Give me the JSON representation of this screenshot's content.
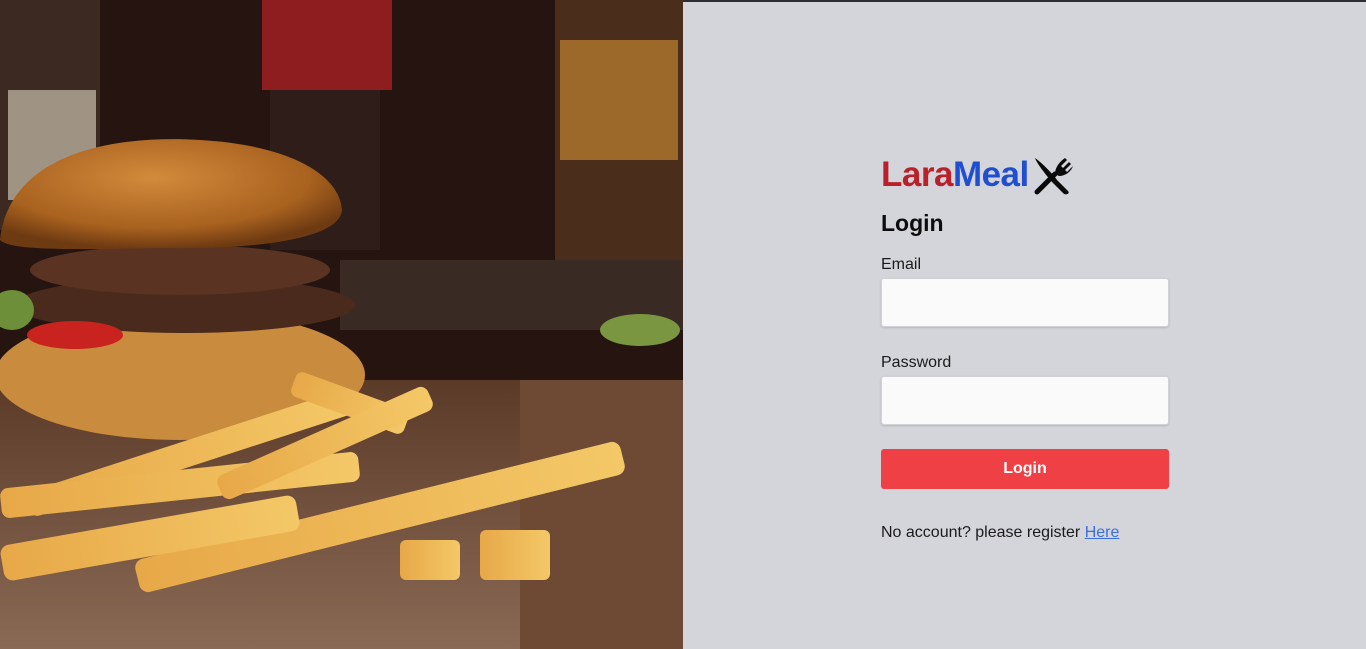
{
  "hero": {
    "image": "burger-and-fries-photo"
  },
  "brand": {
    "part1": "Lara",
    "part2": "Meal",
    "icon": "fork-knife-crossed-icon",
    "color1": "#b9202a",
    "color2": "#1f4fd0"
  },
  "login": {
    "title": "Login",
    "email_label": "Email",
    "email_value": "",
    "password_label": "Password",
    "password_value": "",
    "submit_label": "Login",
    "submit_color": "#ef4145",
    "register_text": "No account? please register",
    "register_link": "Here"
  }
}
